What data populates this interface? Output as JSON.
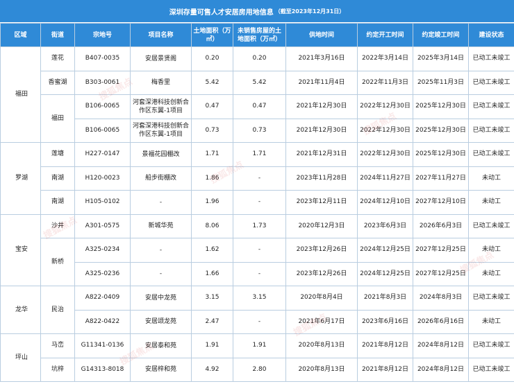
{
  "title": "深圳存量可售人才安居房用地信息",
  "title_note": "（截至2023年12月31日）",
  "watermark": "搜狐焦点",
  "colors": {
    "header_bg": "#2f8ad7",
    "header_text": "#ffffff",
    "grid": "#b9cde0"
  },
  "columns": [
    "区域",
    "街道",
    "宗地号",
    "项目名称",
    "土地面积（万㎡）",
    "未销售房屋的土地面积（万㎡）",
    "供地时间",
    "约定开工时间",
    "约定竣工时间",
    "建设状态"
  ],
  "regions": [
    "福田",
    "罗湖",
    "宝安",
    "龙华",
    "坪山"
  ],
  "streets": [
    "莲花",
    "香蜜湖",
    "福田",
    "莲塘",
    "南湖",
    "南湖",
    "沙井",
    "新桥",
    "民治",
    "马峦",
    "坑梓"
  ],
  "rows": [
    {
      "parcel": "B407-0035",
      "project": "安居景贤阁",
      "land_area": "0.20",
      "unsold_area": "0.20",
      "supply_date": "2021年3月16日",
      "start_date": "2022年3月14日",
      "complete_date": "2025年3月14日",
      "status": "已动工未竣工"
    },
    {
      "parcel": "B303-0061",
      "project": "梅香里",
      "land_area": "5.42",
      "unsold_area": "5.42",
      "supply_date": "2021年11月4日",
      "start_date": "2022年11月3日",
      "complete_date": "2025年11月3日",
      "status": "已动工未竣工"
    },
    {
      "parcel": "B106-0065",
      "project": "河套深港科技创新合作区东翼-1项目",
      "land_area": "0.47",
      "unsold_area": "0.47",
      "supply_date": "2021年12月30日",
      "start_date": "2022年12月30日",
      "complete_date": "2025年12月30日",
      "status": "已动工未竣工"
    },
    {
      "parcel": "B106-0065",
      "project": "河套深港科技创新合作区东翼-1项目",
      "land_area": "0.73",
      "unsold_area": "0.73",
      "supply_date": "2021年12月30日",
      "start_date": "2022年12月30日",
      "complete_date": "2025年12月30日",
      "status": "已动工未竣工"
    },
    {
      "parcel": "H227-0147",
      "project": "景福花园棚改",
      "land_area": "1.71",
      "unsold_area": "1.71",
      "supply_date": "2021年12月31日",
      "start_date": "2022年12月30日",
      "complete_date": "2025年12月30日",
      "status": "已动工未竣工"
    },
    {
      "parcel": "H120-0023",
      "project": "船步街棚改",
      "land_area": "1.86",
      "unsold_area": "-",
      "supply_date": "2023年11月28日",
      "start_date": "2024年11月27日",
      "complete_date": "2027年11月27日",
      "status": "未动工"
    },
    {
      "parcel": "H105-0102",
      "project": "-",
      "land_area": "1.96",
      "unsold_area": "-",
      "supply_date": "2023年12月11日",
      "start_date": "2024年12月10日",
      "complete_date": "2027年12月10日",
      "status": "未动工"
    },
    {
      "parcel": "A301-0575",
      "project": "新城华苑",
      "land_area": "8.06",
      "unsold_area": "1.73",
      "supply_date": "2020年12月3日",
      "start_date": "2023年6月3日",
      "complete_date": "2026年6月3日",
      "status": "已动工未竣工"
    },
    {
      "parcel": "A325-0234",
      "project": "-",
      "land_area": "1.62",
      "unsold_area": "-",
      "supply_date": "2023年12月26日",
      "start_date": "2024年12月25日",
      "complete_date": "2027年12月25日",
      "status": "未动工"
    },
    {
      "parcel": "A325-0236",
      "project": "-",
      "land_area": "1.66",
      "unsold_area": "-",
      "supply_date": "2023年12月26日",
      "start_date": "2024年12月25日",
      "complete_date": "2027年12月25日",
      "status": "未动工"
    },
    {
      "parcel": "A822-0409",
      "project": "安居中龙苑",
      "land_area": "3.15",
      "unsold_area": "3.15",
      "supply_date": "2020年8月4日",
      "start_date": "2021年8月3日",
      "complete_date": "2024年8月3日",
      "status": "已动工未竣工"
    },
    {
      "parcel": "A822-0422",
      "project": "安居颂龙苑",
      "land_area": "2.47",
      "unsold_area": "-",
      "supply_date": "2021年6月17日",
      "start_date": "2023年6月16日",
      "complete_date": "2026年6月16日",
      "status": "未动工"
    },
    {
      "parcel": "G11341-0136",
      "project": "安居泰和苑",
      "land_area": "1.91",
      "unsold_area": "1.91",
      "supply_date": "2020年8月13日",
      "start_date": "2021年8月12日",
      "complete_date": "2024年8月12日",
      "status": "已动工未竣工"
    },
    {
      "parcel": "G14313-8018",
      "project": "安居梓和苑",
      "land_area": "4.92",
      "unsold_area": "2.80",
      "supply_date": "2020年8月13日",
      "start_date": "2021年8月12日",
      "complete_date": "2024年8月12日",
      "status": "已动工未竣工"
    }
  ]
}
